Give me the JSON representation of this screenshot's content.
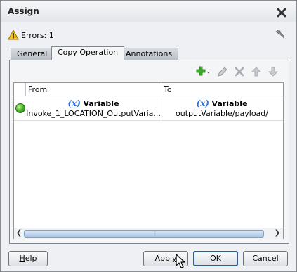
{
  "dialog": {
    "title": "Assign"
  },
  "errors": {
    "text": "Errors: 1"
  },
  "tabs": [
    {
      "label": "General",
      "active": false
    },
    {
      "label": "Copy Operation",
      "active": true
    },
    {
      "label": "Annotations",
      "active": false
    }
  ],
  "toolbar": {
    "icons": [
      "add-icon",
      "edit-icon",
      "delete-icon",
      "move-up-icon",
      "move-down-icon"
    ]
  },
  "table": {
    "columns": [
      "From",
      "To"
    ],
    "rows": [
      {
        "status": "valid",
        "from": {
          "fx": "(x)",
          "type": "Variable",
          "path": "Invoke_1_LOCATION_OutputVaria..."
        },
        "to": {
          "fx": "(x)",
          "type": "Variable",
          "path": "outputVariable/payload/"
        }
      }
    ]
  },
  "buttons": {
    "help_pre": "",
    "help_mn": "H",
    "help_post": "elp",
    "apply_pre": "Appl",
    "apply_mn": "y",
    "apply_post": "",
    "ok": "OK",
    "cancel": "Cancel"
  },
  "colors": {
    "accent": "#2a6fd6",
    "ok_border": "#2f5d99",
    "status_green": "#3fae20",
    "warning": "#f0c020"
  }
}
